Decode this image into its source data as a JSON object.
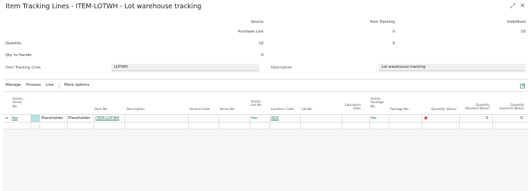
{
  "title": "Item Tracking Lines - ITEM-LOTWH - Lot warehouse tracking",
  "window": {
    "expand_glyph": "⤢",
    "close_glyph": "✕"
  },
  "summary": {
    "col_source": "Source",
    "col_item_tracking": "Item Tracking",
    "col_undefined": "Undefined",
    "source_type": "Purchase Line",
    "source_it_val": "0",
    "source_undef_val": "10",
    "quantity_label": "Quantity",
    "quantity_source": "10",
    "quantity_it": "0",
    "qty_handle_label": "Qty. to Handle",
    "qty_handle_source": "0"
  },
  "fields": {
    "itc_label": "Item Tracking Code",
    "itc_value": "LOTWH",
    "desc_label": "Description",
    "desc_value": "Lot warehouse tracking"
  },
  "actions": {
    "manage": "Manage",
    "process": "Process",
    "line": "Line",
    "more": "More options"
  },
  "grid": {
    "headers": {
      "avail_serial": [
        "Availa...",
        "Serial",
        "No."
      ],
      "item_no": "Item No.",
      "description": "Description",
      "variant_code": "Variant Code",
      "serial_no": "Serial No.",
      "avail_lot": [
        "Availa...",
        "Lot No."
      ],
      "location_code": "Location Code",
      "lot_no": "Lot No.",
      "expiration": [
        "Expiration",
        "Date"
      ],
      "avail_package": [
        "Availa...",
        "Package",
        "No."
      ],
      "package_no": "Package No.",
      "quantity_base": "Quantity (Base)",
      "qty_handled": [
        "Quantity",
        "Handled (Base)"
      ],
      "qty_invoiced": [
        "Quantity",
        "Invoiced (Base)"
      ]
    },
    "row": {
      "arrow": "→",
      "avail_serial": "Yes",
      "placeholder1": "Placeholder",
      "placeholder2": "Placeholder",
      "item_no": "ITEM-LOTWH",
      "avail_lot": "Yes",
      "location_code": "ADV",
      "avail_package": "Yes",
      "required_mark": "✱",
      "qty_handled": "0",
      "qty_invoiced": "0"
    }
  },
  "colors": {
    "accent": "#1f6f5d",
    "selection_cell": "#b4e2e6",
    "required": "#d13438"
  }
}
